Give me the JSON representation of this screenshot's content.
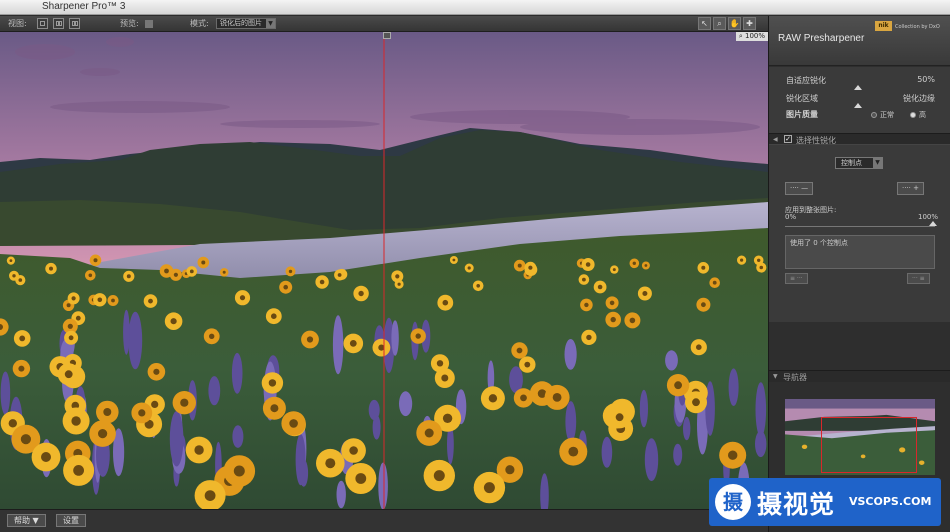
{
  "app": {
    "title": "Sharpener Pro™ 3"
  },
  "toolbar": {
    "view_label": "视图:",
    "preview_label": "预览:",
    "mode_label": "模式:",
    "mode_value": "锐化后的图片",
    "zoom_value": "100%"
  },
  "bottombar": {
    "help_label": "帮助 ▼",
    "settings_label": "设置"
  },
  "panel": {
    "brand_badge": "nik",
    "collection_text": "Collection by DxO",
    "title": "RAW Presharpener",
    "adaptive_label": "自适应锐化",
    "adaptive_value": "50%",
    "area_label": "锐化区域",
    "edge_label": "锐化边缘",
    "area_level": 0.49,
    "quality_label": "图片质量",
    "quality_normal": "正常",
    "quality_high": "高",
    "quality_selected": "high",
    "selective_header": "选择性锐化",
    "selective_checked": true,
    "control_point_select": "控制点",
    "apply_label": "应用到整张图片:",
    "apply_min": "0%",
    "apply_max": "100%",
    "control_points_text": "使用了 0 个控制点",
    "navigator_header": "导航器"
  },
  "watermark": {
    "logo_glyph": "摄",
    "cn_text": "摄视觉",
    "en_text": "VSCOPS.COM"
  },
  "colors": {
    "split_line": "#d8272b",
    "watermark_bg": "#1f63c9"
  }
}
